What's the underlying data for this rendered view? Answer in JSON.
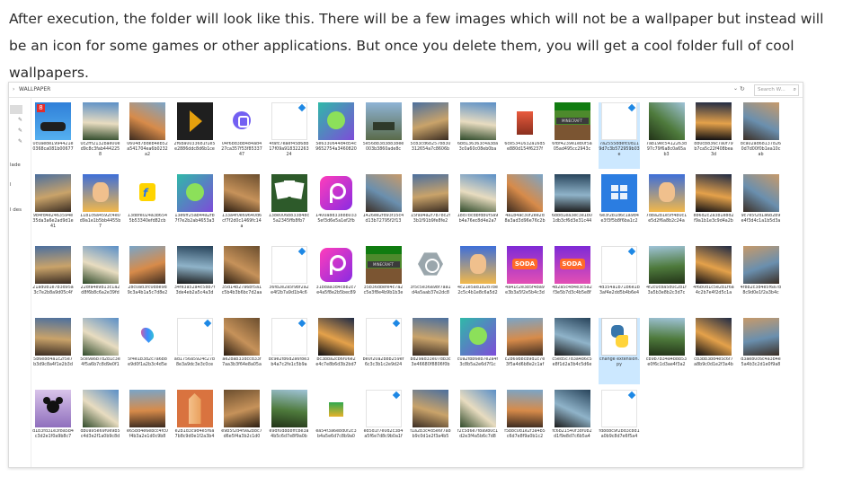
{
  "article": {
    "paragraph": "After execution, the folder will look like this. There will be a few images which will not be a wallpaper but instead will be an icon for some games or other applications. But once you delete them, you will get a cool folder full of cool wallpapers."
  },
  "explorer": {
    "chevron": "›",
    "path": "WALLPAPER",
    "dropdown": "⌄",
    "refresh": "↻",
    "search_placeholder": "Search W...",
    "search_icon": "⌕",
    "pin_glyph": "✎",
    "nav_labels": [
      "lade",
      "l",
      "l des"
    ]
  },
  "files": [
    {
      "name": "0c0aede1994421e0368ca081b00677",
      "type": "game-car"
    },
    {
      "name": "0c2fff2132bae00ed9c8c3fab4442258",
      "type": "landscape"
    },
    {
      "name": "0604d7bdeb4eb52a541704ea6b0232a2",
      "type": "landscape"
    },
    {
      "name": "2f6ba0033681f1e5e2886ddc8d6b1ce",
      "type": "plex-icon"
    },
    {
      "name": "04f6bd3bb484ad427ca357f53f8533747",
      "type": "viber-icon"
    },
    {
      "name": "4fafc7eaef45b68b17f09a91832226324",
      "type": "blank"
    },
    {
      "name": "5e6330644d4d54c9652754a3460820",
      "type": "game-dragon"
    },
    {
      "name": "5e568b3d38838ee003b3860ade8c",
      "type": "game-tank"
    },
    {
      "name": "5c83cd682578830312654a7c8606b",
      "type": "landscape"
    },
    {
      "name": "6bd136363c4a3ba3c0a60c08eb0ba",
      "type": "landscape"
    },
    {
      "name": "6ce5341632a16d5e880d154f6237f",
      "type": "figure"
    },
    {
      "name": "6fbf4239e1eb0f5a05ad495cc2943c",
      "type": "minecraft-xbox"
    },
    {
      "name": "7a2555ddefc0d119d7c3b572959b03e",
      "type": "blank",
      "selected": true
    },
    {
      "name": "7ab19ec5412263d97c79f6a8c0a65ab3",
      "type": "landscape"
    },
    {
      "name": "8b0c8836c7a0f79b7ca5c22f408bea3d",
      "type": "landscape"
    },
    {
      "name": "8ca02ad681378260d7d00f0b1ea10cab",
      "type": "landscape"
    },
    {
      "name": "9b4fd4e2463594e35da3a6e2ad9d1e41",
      "type": "landscape"
    },
    {
      "name": "11b1c6a4592c4e0d9a1e1b5bb4455b7",
      "type": "game-cartoon"
    },
    {
      "name": "13d8fe024a3b6545b53340efd82cb",
      "type": "flipkart-icon"
    },
    {
      "name": "13e6ff25ab44a2fb7f7e2b2ab4653a3",
      "type": "game-dragon"
    },
    {
      "name": "133a4f0e69640d6cf7f2d0c1469fc14a",
      "type": "landscape"
    },
    {
      "name": "138e006b833b48c5a2345ffb8fb7",
      "type": "cards"
    },
    {
      "name": "1400a8d3388b0335ef3d6e5a1ef2fb",
      "type": "picsart-icon"
    },
    {
      "name": "1426ee2fd93f35c4d13b72795f2f13",
      "type": "landscape"
    },
    {
      "name": "15fa94a2f7b78c2f3b1f91b9fe8fe2",
      "type": "landscape"
    },
    {
      "name": "18d7bcdbfdb0f5a9b4a76ec8d4e2a7",
      "type": "landscape"
    },
    {
      "name": "4a1b4ac30f2ee2d8a3ad3d96e76c2b",
      "type": "landscape"
    },
    {
      "name": "6bbd1ea3ec3e1b01db3cf6d3e31c44",
      "type": "landscape"
    },
    {
      "name": "6e3f2b1d6c1a9d4e3f3f5b8f6ba1c2",
      "type": "windows-store"
    },
    {
      "name": "7d8a2b1e5ff4b0c1e5d2f6a8b2c24a",
      "type": "game-cartoon"
    },
    {
      "name": "8b6d2c2a3b1e8d2f9a1b1e3c9d4a2b",
      "type": "landscape"
    },
    {
      "name": "9c7e5f2d1a6b2b9e4f3d4c1a1b5d3a",
      "type": "landscape"
    },
    {
      "name": "21ad0b1e7b3d95a3c7e2b8a9d05c4f",
      "type": "landscape"
    },
    {
      "name": "22dfa4e9b13c1a2d8f6b8c6a2e39fd",
      "type": "landscape"
    },
    {
      "name": "28c0ad3fc0d8e9d9c3a4b1a5c7d8e2",
      "type": "landscape"
    },
    {
      "name": "34fe3a52a4c58b7f3de4eb2a5c4a3d",
      "type": "landscape"
    },
    {
      "name": "35d14b27a6bf5a1c5b4b3b6bc7d2aa",
      "type": "landscape"
    },
    {
      "name": "36fb2e2a5f9bf2a2e4f2b7a9d1b4c6",
      "type": "blank"
    },
    {
      "name": "31bdaa3d4c8b2c7e4a5f8e2b5bec89",
      "type": "picsart-icon"
    },
    {
      "name": "35b36dbefe4c7a2c5e3f8e4b9b1b3e",
      "type": "minecraft-xbox"
    },
    {
      "name": "3f5c5e36a98f7aa1d4a5aab37e2dc8",
      "type": "gear-icon"
    },
    {
      "name": "4c21e5ad1b2d7be2c5c4b1e8c6a5d2",
      "type": "game-cartoon"
    },
    {
      "name": "4a41c2e3b5f4ba9e3b3a5f2e5b4c3d",
      "type": "soda-game"
    },
    {
      "name": "4b2a5c4d4e3c5a2f3e5b7d3c4b5e8f",
      "type": "soda-game"
    },
    {
      "name": "4d354a1b71b6e1b3af4e2dd5b4b6e4",
      "type": "blank"
    },
    {
      "name": "4f2c0c8a5d0c2b1f3a5b3e8b2c3d7c",
      "type": "landscape"
    },
    {
      "name": "4f6b0d1c5e2b1f6a4c2b7e4f2d5c1a",
      "type": "landscape"
    },
    {
      "name": "4f8b2c3d4e5f6a7b8c9d0e1f2a3b4c",
      "type": "landscape"
    },
    {
      "name": "5b6e8d4a1c2f5e7b3d9c8a4f1e2b3d",
      "type": "landscape"
    },
    {
      "name": "5ce9a6b7d2b1c3e4f5a6b7c8d9e0f1",
      "type": "landscape"
    },
    {
      "name": "5f4e1b3d2c7a6b8e9d0f1a2b3c4d5e",
      "type": "paint-icon"
    },
    {
      "name": "ad1756a5924c27b8e3a9dc3e3c0ce",
      "type": "blank"
    },
    {
      "name": "ae2bab33dccd33f7aa3b3f64e8a05a",
      "type": "landscape"
    },
    {
      "name": "bc9e2fb6d2a6f8e3b4a7c2fe1c5b9a",
      "type": "blank"
    },
    {
      "name": "bc3bba2cb6f06e2e4c7e8b6d3b2bd7",
      "type": "landscape"
    },
    {
      "name": "be0f20a2b8b259ef6c3c3b1c2e9d24",
      "type": "blank"
    },
    {
      "name": "bd29ad33e07db3c3e46680f8806f0b",
      "type": "landscape"
    },
    {
      "name": "c0a2fbb6eb7e2a4f3c8b5a2e6d7f1c",
      "type": "game-dragon"
    },
    {
      "name": "c2b69b8cb9d1c7e3f5a4d6b8e2c1af",
      "type": "landscape"
    },
    {
      "name": "c5ed5c7d3a4b6c5e8f1d2a3b4c5d6e",
      "type": "landscape"
    },
    {
      "name": "change extension.py",
      "type": "python-icon",
      "selected": true
    },
    {
      "name": "cb9b7b34a4b8b53e0f6c1d3ae4f3a2",
      "type": "landscape"
    },
    {
      "name": "cd3bb3bd4e5c6f7a8b9c0d1e2f3a4b",
      "type": "landscape"
    },
    {
      "name": "d3ae80c6c4a3b4e5a4b3c2d1e0f9a8",
      "type": "landscape"
    },
    {
      "name": "d1b3fd31e3f8a5b4c3d2e1f0a9b8c7",
      "type": "disney-icon"
    },
    {
      "name": "db0a95e69f0e9b5c4d3e2f1a0b9c8d",
      "type": "landscape"
    },
    {
      "name": "e65bd4e6ebcc4fc0f4b3a2e1d0c9b8",
      "type": "landscape"
    },
    {
      "name": "e2b1d3c9d4e5f6a7b8c9d0e1f2a3b4",
      "type": "pencil-icon"
    },
    {
      "name": "e9b5f2d4f9a2b8c7d6e5f4a3b2c1d0",
      "type": "landscape"
    },
    {
      "name": "e9df0d8b8ffc8e3a4b5c6d7e8f9a0b",
      "type": "landscape"
    },
    {
      "name": "ea54f3a6e8d0f2c3b4a5e6d7c8b9a0",
      "type": "small-game"
    },
    {
      "name": "ed5d1f7e0d2c3b4a5f6e7d8c9b0a1f",
      "type": "blank"
    },
    {
      "name": "f1a2b3c4d5e6f7a8b9c0d1e2f3a4b5",
      "type": "landscape"
    },
    {
      "name": "f2c5d6e7f8a9b0c1d2e3f4a5b6c7d8",
      "type": "landscape"
    },
    {
      "name": "f5b8c0d1e2f3a4b5c6d7e8f9a0b1c2",
      "type": "landscape"
    },
    {
      "name": "fc6b21540f38f0b2d1f9e8d7c6b5a4",
      "type": "landscape"
    },
    {
      "name": "fd8d8c9f2bd3c8d1a0b9c8d7e6f5a4",
      "type": "blank"
    }
  ]
}
